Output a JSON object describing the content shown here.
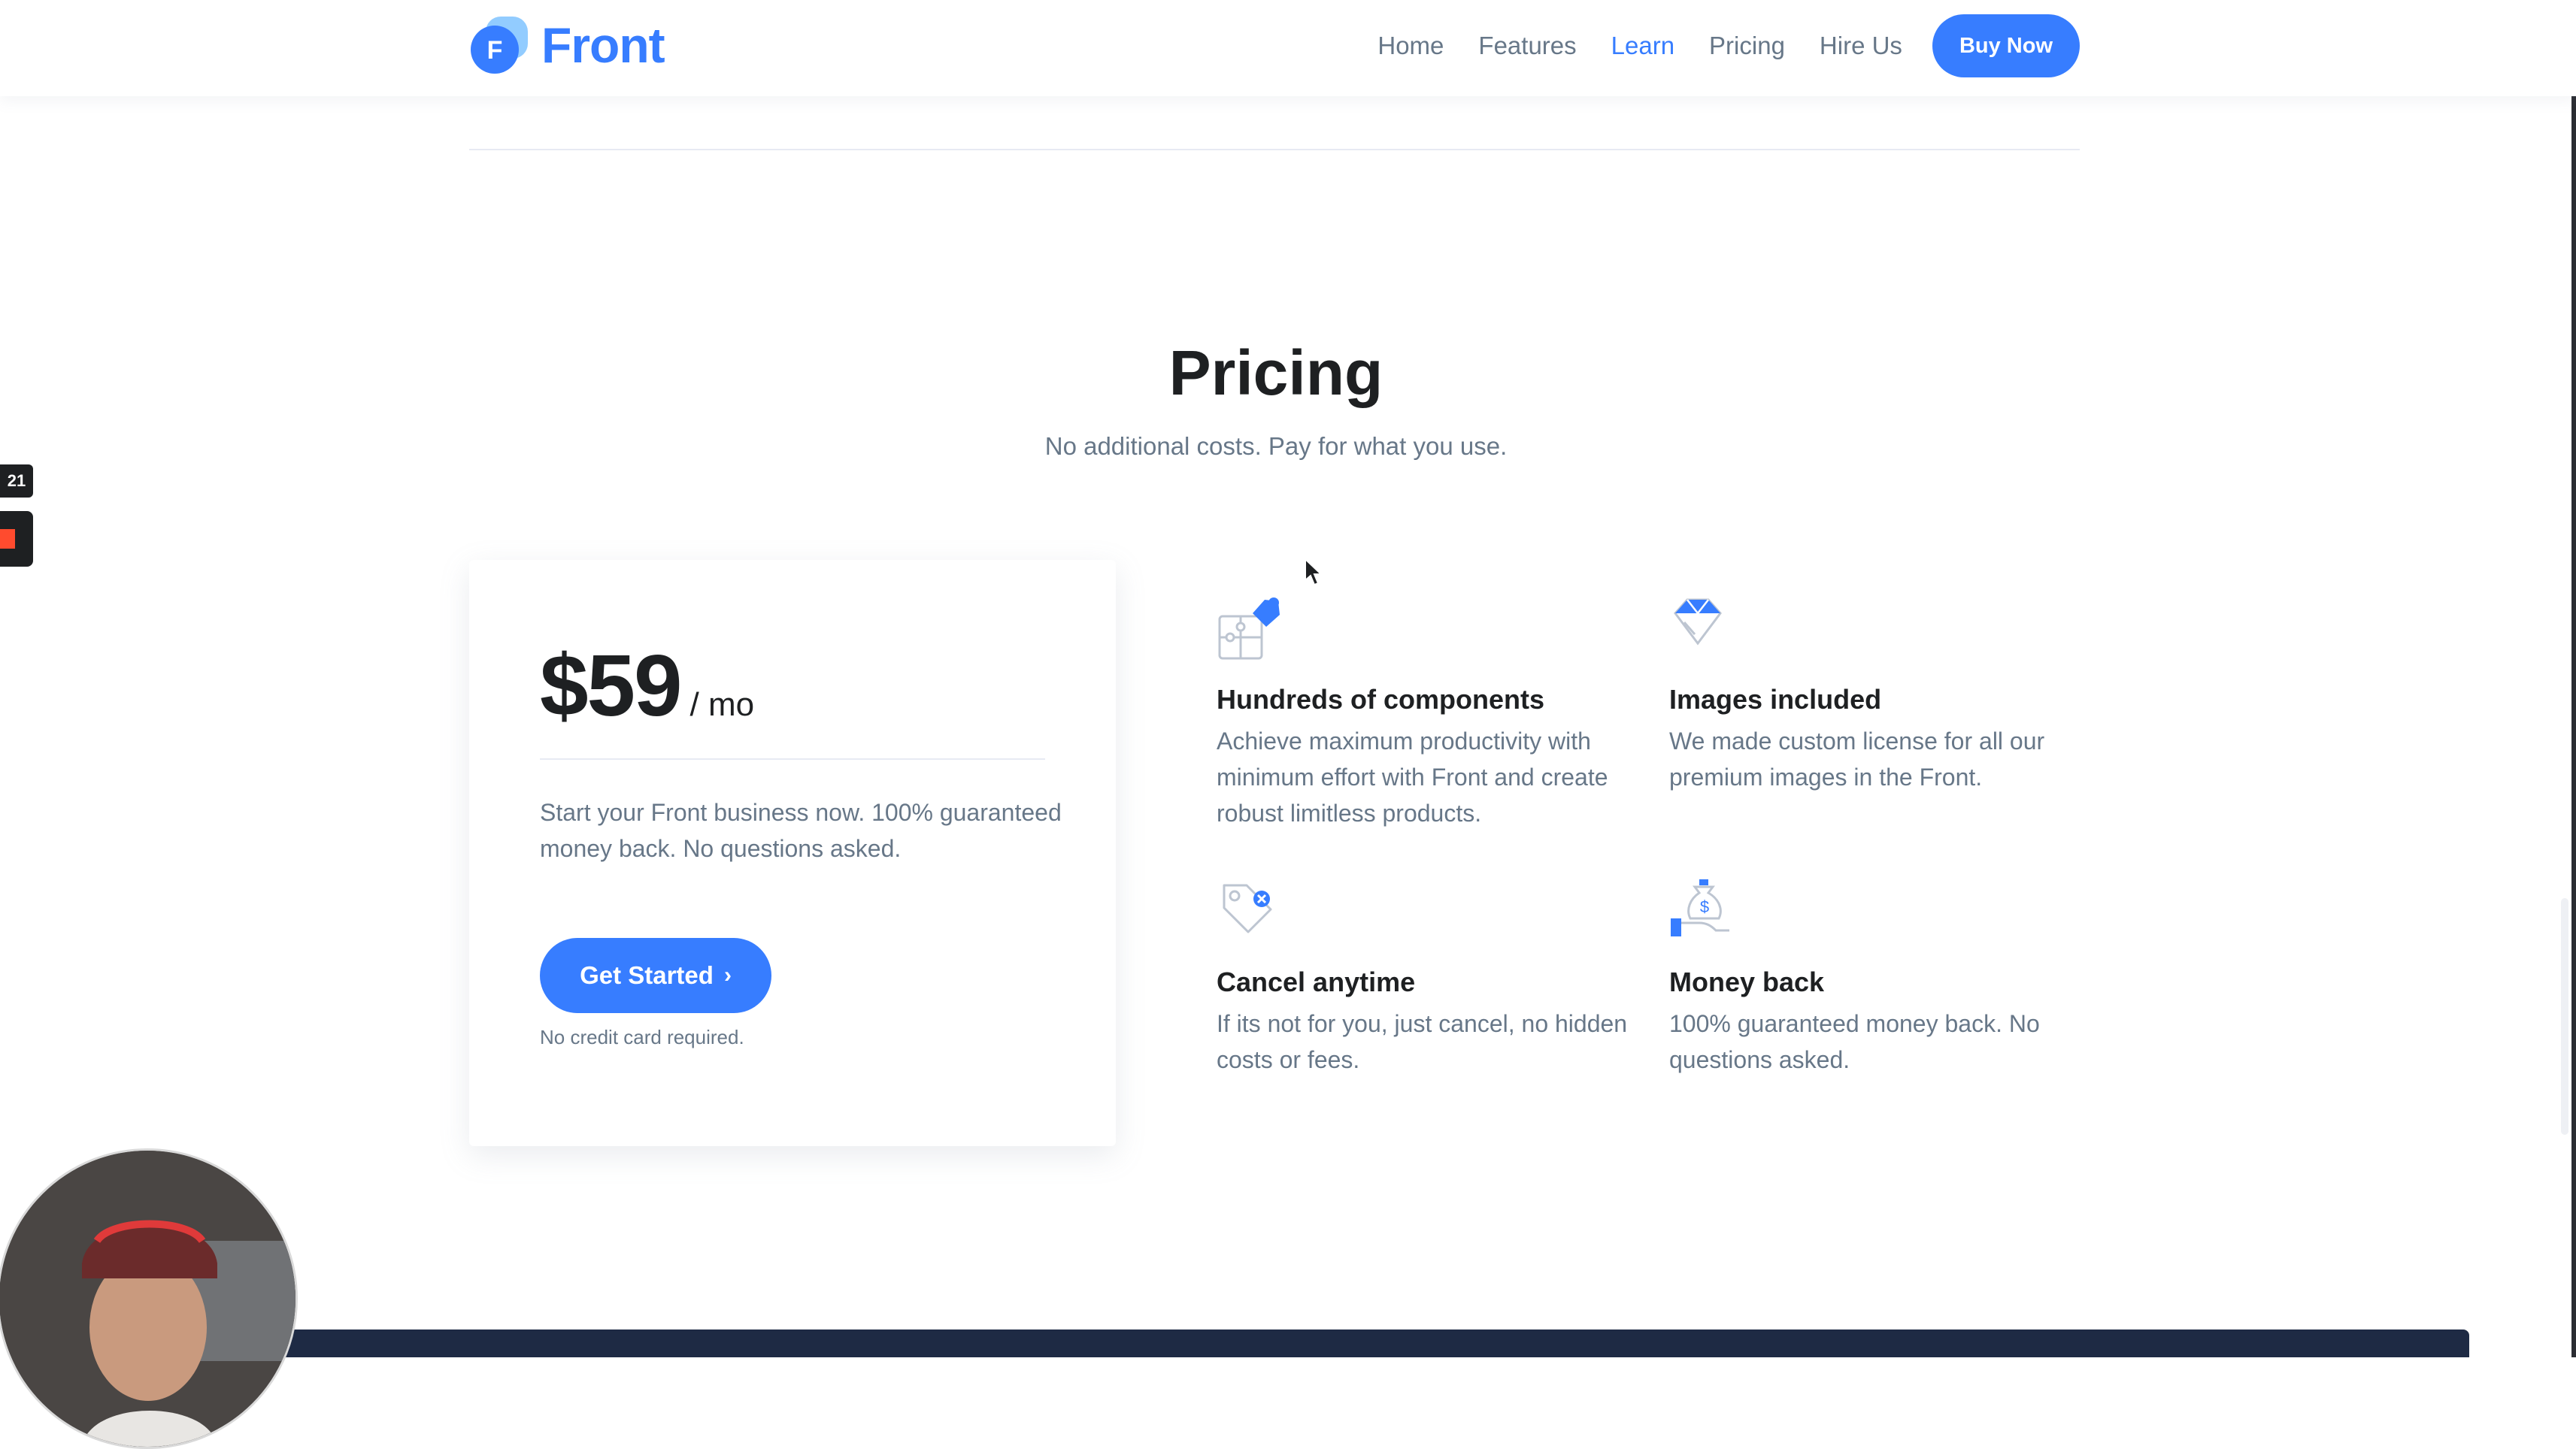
{
  "header": {
    "logo_letter": "F",
    "logo_text": "Front",
    "nav": [
      {
        "label": "Home",
        "active": false
      },
      {
        "label": "Features",
        "active": false
      },
      {
        "label": "Learn",
        "active": true
      },
      {
        "label": "Pricing",
        "active": false
      },
      {
        "label": "Hire Us",
        "active": false
      }
    ],
    "buy_button": "Buy Now"
  },
  "pricing": {
    "title": "Pricing",
    "subtitle": "No additional costs. Pay for what you use.",
    "card": {
      "amount": "$59",
      "period": "/ mo",
      "description": "Start your Front business now. 100% guaranteed money back. No questions asked.",
      "cta": "Get Started",
      "cta_icon": "chevron-right-icon",
      "note": "No credit card required."
    },
    "features": [
      {
        "icon": "puzzle-icon",
        "title": "Hundreds of components",
        "description": "Achieve maximum productivity with minimum effort with Front and create robust limitless products."
      },
      {
        "icon": "diamond-icon",
        "title": "Images included",
        "description": "We made custom license for all our premium images in the Front."
      },
      {
        "icon": "price-tag-icon",
        "title": "Cancel anytime",
        "description": "If its not for you, just cancel, no hidden costs or fees."
      },
      {
        "icon": "money-bag-icon",
        "title": "Money back",
        "description": "100% guaranteed money back. No questions asked."
      }
    ]
  },
  "overlay": {
    "recorder_badge": "21"
  },
  "colors": {
    "primary": "#377dff",
    "heading": "#1e2022",
    "body_text": "#677788",
    "divider": "#e7eaf3"
  }
}
